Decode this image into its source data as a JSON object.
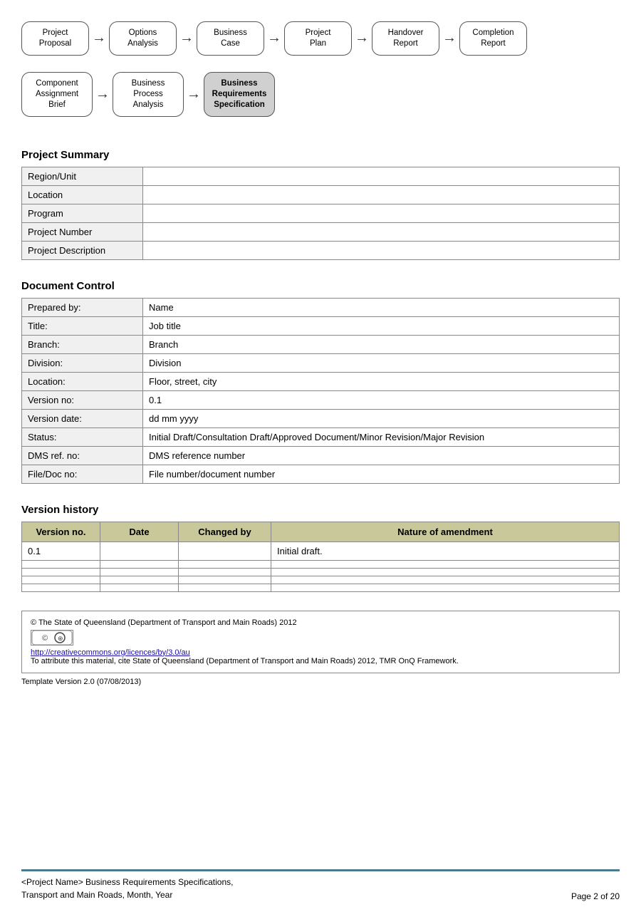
{
  "flow1": {
    "items": [
      {
        "label": "Project\nProposal",
        "highlighted": false
      },
      {
        "label": "Options\nAnalysis",
        "highlighted": false
      },
      {
        "label": "Business\nCase",
        "highlighted": false
      },
      {
        "label": "Project\nPlan",
        "highlighted": false
      },
      {
        "label": "Handover\nReport",
        "highlighted": false
      },
      {
        "label": "Completion\nReport",
        "highlighted": false
      }
    ]
  },
  "flow2": {
    "items": [
      {
        "label": "Component\nAssignment\nBrief",
        "highlighted": false
      },
      {
        "label": "Business\nProcess\nAnalysis",
        "highlighted": false
      },
      {
        "label": "Business\nRequirements\nSpecification",
        "highlighted": true
      }
    ]
  },
  "project_summary": {
    "title": "Project Summary",
    "rows": [
      {
        "label": "Region/Unit",
        "value": ""
      },
      {
        "label": "Location",
        "value": ""
      },
      {
        "label": "Program",
        "value": ""
      },
      {
        "label": "Project Number",
        "value": ""
      },
      {
        "label": "Project Description",
        "value": ""
      }
    ]
  },
  "document_control": {
    "title": "Document Control",
    "rows": [
      {
        "label": "Prepared by:",
        "value": "Name"
      },
      {
        "label": "Title:",
        "value": "Job title"
      },
      {
        "label": "Branch:",
        "value": "Branch"
      },
      {
        "label": "Division:",
        "value": "Division"
      },
      {
        "label": "Location:",
        "value": "Floor, street, city"
      },
      {
        "label": "Version no:",
        "value": "0.1"
      },
      {
        "label": "Version date:",
        "value": "dd mm yyyy"
      },
      {
        "label": "Status:",
        "value": "Initial Draft/Consultation Draft/Approved Document/Minor Revision/Major Revision"
      },
      {
        "label": "DMS ref. no:",
        "value": "DMS reference number"
      },
      {
        "label": "File/Doc no:",
        "value": "File number/document number"
      }
    ]
  },
  "version_history": {
    "title": "Version history",
    "headers": [
      "Version no.",
      "Date",
      "Changed by",
      "Nature of amendment"
    ],
    "rows": [
      {
        "version": "0.1",
        "date": "",
        "changed_by": "",
        "amendment": "Initial draft."
      },
      {
        "version": "",
        "date": "",
        "changed_by": "",
        "amendment": ""
      },
      {
        "version": "",
        "date": "",
        "changed_by": "",
        "amendment": ""
      },
      {
        "version": "",
        "date": "",
        "changed_by": "",
        "amendment": ""
      },
      {
        "version": "",
        "date": "",
        "changed_by": "",
        "amendment": ""
      }
    ]
  },
  "footer": {
    "copyright": "© The State of Queensland (Department of Transport and Main Roads) 2012",
    "cc_symbols": "© ⊕",
    "link": "http://creativecommons.org/licences/by/3.0/au",
    "attribution": "To attribute this material, cite State of Queensland (Department of Transport and Main Roads) 2012, TMR OnQ Framework.",
    "template_version": "Template Version 2.0 (07/08/2013)"
  },
  "page_footer": {
    "left_line1": "<Project Name> Business Requirements Specifications,",
    "left_line2": "Transport and Main Roads, Month, Year",
    "page_label": "Page 2 of 20"
  }
}
